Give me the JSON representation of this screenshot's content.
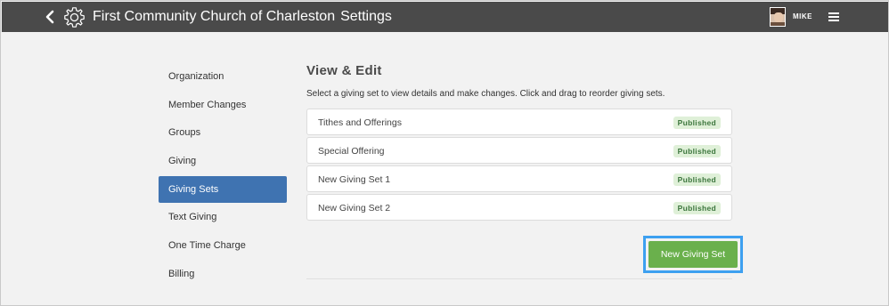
{
  "header": {
    "title": "First Community Church of Charleston",
    "section": "Settings",
    "user": "MIKE",
    "icons": {
      "back": "chevron-left-icon",
      "gear": "gear-icon",
      "menu": "hamburger-menu-icon"
    }
  },
  "sidebar": {
    "items": [
      {
        "label": "Organization"
      },
      {
        "label": "Member Changes"
      },
      {
        "label": "Groups"
      },
      {
        "label": "Giving"
      },
      {
        "label": "Giving Sets",
        "active": true
      },
      {
        "label": "Text Giving"
      },
      {
        "label": "One Time Charge"
      },
      {
        "label": "Billing"
      }
    ]
  },
  "main": {
    "title": "View & Edit",
    "description": "Select a giving set to view details and make changes. Click and drag to reorder giving sets.",
    "giving_sets": [
      {
        "name": "Tithes and Offerings",
        "status": "Published"
      },
      {
        "name": "Special Offering",
        "status": "Published"
      },
      {
        "name": "New Giving Set 1",
        "status": "Published"
      },
      {
        "name": "New Giving Set 2",
        "status": "Published"
      }
    ],
    "new_button": "New Giving Set"
  },
  "colors": {
    "topbar": "#4a4a4a",
    "active_nav": "#3f73b1",
    "badge_bg": "#dff0d8",
    "badge_text": "#3c763d",
    "primary_button": "#6ab04c",
    "highlight": "#3da0f0"
  }
}
